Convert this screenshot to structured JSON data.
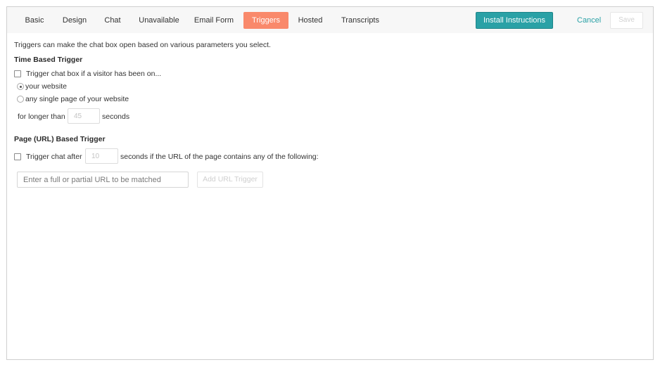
{
  "tabs": [
    {
      "label": "Basic",
      "active": false
    },
    {
      "label": "Design",
      "active": false
    },
    {
      "label": "Chat",
      "active": false
    },
    {
      "label": "Unavailable",
      "active": false
    },
    {
      "label": "Email Form",
      "active": false
    },
    {
      "label": "Triggers",
      "active": true
    },
    {
      "label": "Hosted",
      "active": false
    },
    {
      "label": "Transcripts",
      "active": false
    }
  ],
  "actions": {
    "install_label": "Install Instructions",
    "cancel_label": "Cancel",
    "save_label": "Save"
  },
  "intro": "Triggers can make the chat box open based on various parameters you select.",
  "time_trigger": {
    "heading": "Time Based Trigger",
    "checkbox_label": "Trigger chat box if a visitor has been on...",
    "checkbox_checked": false,
    "options": [
      {
        "label": "your website",
        "checked": true
      },
      {
        "label": "any single page of your website",
        "checked": false
      }
    ],
    "prefix": "for longer than",
    "seconds_placeholder": "45",
    "suffix": "seconds"
  },
  "url_trigger": {
    "heading": "Page (URL) Based Trigger",
    "checkbox_label": "Trigger chat after",
    "checkbox_checked": false,
    "seconds_placeholder": "10",
    "suffix": "seconds if the URL of the page contains any of the following:",
    "url_placeholder": "Enter a full or partial URL to be matched",
    "add_button_label": "Add URL Trigger"
  },
  "colors": {
    "accent_teal": "#2aa1a6",
    "active_tab": "#f9896b",
    "topbar_bg": "#f7f7f7"
  }
}
